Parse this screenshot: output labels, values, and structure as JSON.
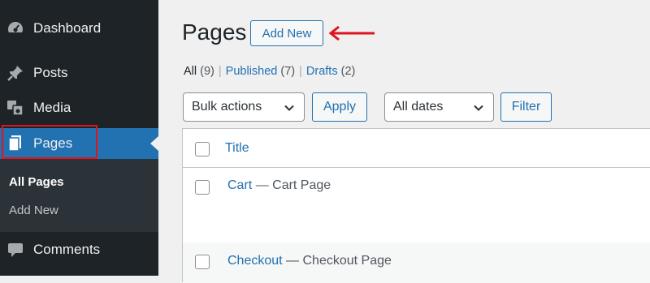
{
  "sidebar": {
    "items": [
      {
        "label": "Dashboard",
        "icon": "dashboard-icon"
      },
      {
        "label": "Posts",
        "icon": "pin-icon"
      },
      {
        "label": "Media",
        "icon": "media-icon"
      },
      {
        "label": "Pages",
        "icon": "pages-icon",
        "active": true
      },
      {
        "label": "Comments",
        "icon": "comment-icon"
      }
    ],
    "submenu": [
      {
        "label": "All Pages",
        "current": true
      },
      {
        "label": "Add New"
      }
    ]
  },
  "header": {
    "title": "Pages",
    "add_new_label": "Add New"
  },
  "filters": {
    "all": {
      "label": "All",
      "count": "(9)"
    },
    "published": {
      "label": "Published",
      "count": "(7)"
    },
    "drafts": {
      "label": "Drafts",
      "count": "(2)"
    },
    "separator": "|"
  },
  "tablenav": {
    "bulk_actions": "Bulk actions",
    "apply_label": "Apply",
    "dates": "All dates",
    "filter_label": "Filter"
  },
  "table": {
    "columns": [
      "Title"
    ],
    "rows": [
      {
        "title": "Cart",
        "state": "— Cart Page"
      },
      {
        "title": "Checkout",
        "state": "— Checkout Page"
      }
    ]
  },
  "colors": {
    "sidebar_bg": "#1d2327",
    "active_bg": "#2271b1",
    "link": "#2271b1",
    "highlight": "#e0141e"
  }
}
